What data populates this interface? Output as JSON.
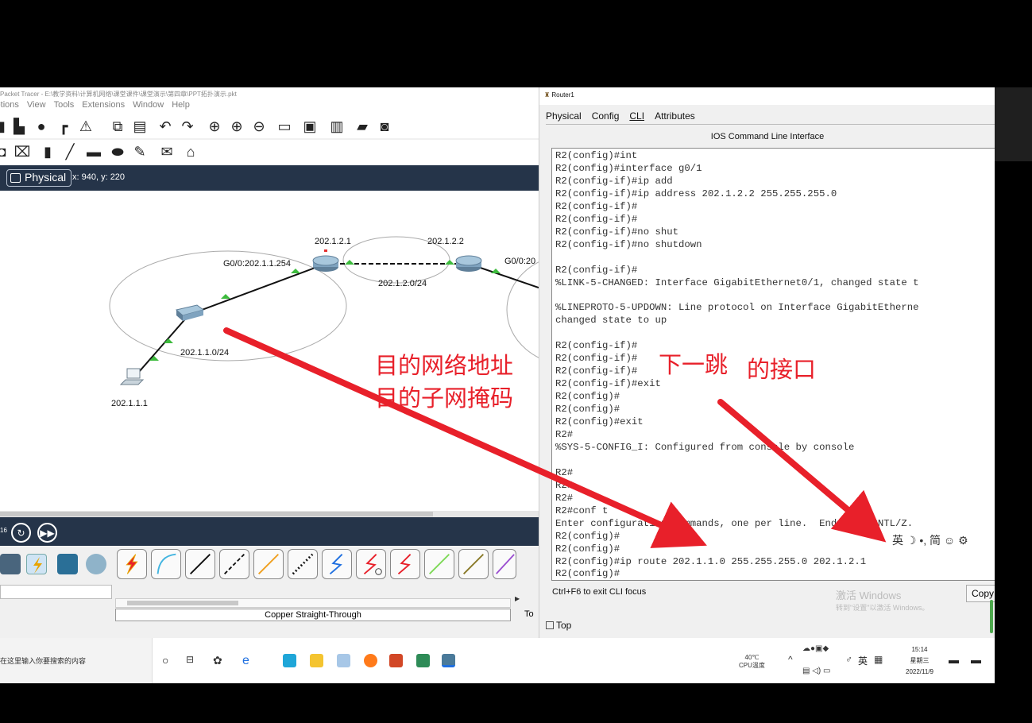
{
  "colors": {
    "accent_blue": "#253449",
    "annotation_red": "#e8202a",
    "link_green": "#3dbb3d"
  },
  "pt": {
    "title": "Packet Tracer - E:\\教学资料\\计算机网络\\课堂课件\\课堂演示\\第四章\\PPT拓扑演示.pkt",
    "menu": [
      "Options",
      "View",
      "Tools",
      "Extensions",
      "Window",
      "Help"
    ],
    "toolbar1_icons": [
      "save-icon",
      "print-icon",
      "activity-wizard-icon",
      "cisco-icon",
      "custom-device-icon",
      "copy-icon",
      "paste-icon",
      "undo-icon",
      "redo-icon",
      "zoom-in-icon",
      "zoom-reset-icon",
      "zoom-out-icon",
      "drawing-palette-icon",
      "custom-devices-icon",
      "device-list-icon",
      "network-info-icon",
      "snapshot-icon"
    ],
    "toolbar2_icons": [
      "select-icon",
      "inspect-icon",
      "note-icon",
      "line-icon",
      "rectangle-icon",
      "ellipse-icon",
      "freeform-icon",
      "pdu-icon",
      "complex-pdu-icon"
    ],
    "physical_tab": "Physical",
    "coords": "x: 940, y: 220",
    "topology": {
      "r1_gw": "G0/0:202.1.1.254",
      "r1_ip": "202.1.2.1",
      "r2_ip": "202.1.2.2",
      "link_net": "202.1.2.0/24",
      "lan_net": "202.1.1.0/24",
      "pc_ip": "202.1.1.1",
      "r2_gw_partial": "G0/0:20"
    },
    "sim_num": "16",
    "cable_name": "Copper Straight-Through",
    "tog_label": "To"
  },
  "router": {
    "title": "Router1",
    "tabs": [
      "Physical",
      "Config",
      "CLI",
      "Attributes"
    ],
    "header": "IOS Command Line Interface",
    "cli_lines": [
      "R2(config)#int",
      "R2(config)#interface g0/1",
      "R2(config-if)#ip add",
      "R2(config-if)#ip address 202.1.2.2 255.255.255.0",
      "R2(config-if)#",
      "R2(config-if)#",
      "R2(config-if)#no shut",
      "R2(config-if)#no shutdown",
      "",
      "R2(config-if)#",
      "%LINK-5-CHANGED: Interface GigabitEthernet0/1, changed state t",
      "",
      "%LINEPROTO-5-UPDOWN: Line protocol on Interface GigabitEtherne",
      "changed state to up",
      "",
      "R2(config-if)#",
      "R2(config-if)#",
      "R2(config-if)#",
      "R2(config-if)#exit",
      "R2(config)#",
      "R2(config)#",
      "R2(config)#exit",
      "R2#",
      "%SYS-5-CONFIG_I: Configured from console by console",
      "",
      "R2#",
      "R2#",
      "R2#",
      "R2#conf t",
      "Enter configuration commands, one per line.  End with CNTL/Z.",
      "R2(config)#",
      "R2(config)#",
      "R2(config)#ip route 202.1.1.0 255.255.255.0 202.1.2.1",
      "R2(config)#"
    ],
    "ime_bar": "英 ☽ •, 简 ☺ ⚙",
    "exit_hint": "Ctrl+F6 to exit CLI focus",
    "copy_label": "Copy",
    "top_label": "Top",
    "watermark1": "激活 Windows",
    "watermark2": "转到\"设置\"以激活 Windows。"
  },
  "annotations": {
    "dest_net": "目的网络地址",
    "dest_mask": "目的子网掩码",
    "next_hop": "下一跳",
    "interface": "的接口"
  },
  "taskbar": {
    "search_text": "在这里输入你要搜索的内容",
    "temp": "40℃",
    "temp_label": "CPU温度",
    "ime": "英",
    "time": "15:14",
    "weekday": "星期三",
    "date": "2022/11/9"
  }
}
